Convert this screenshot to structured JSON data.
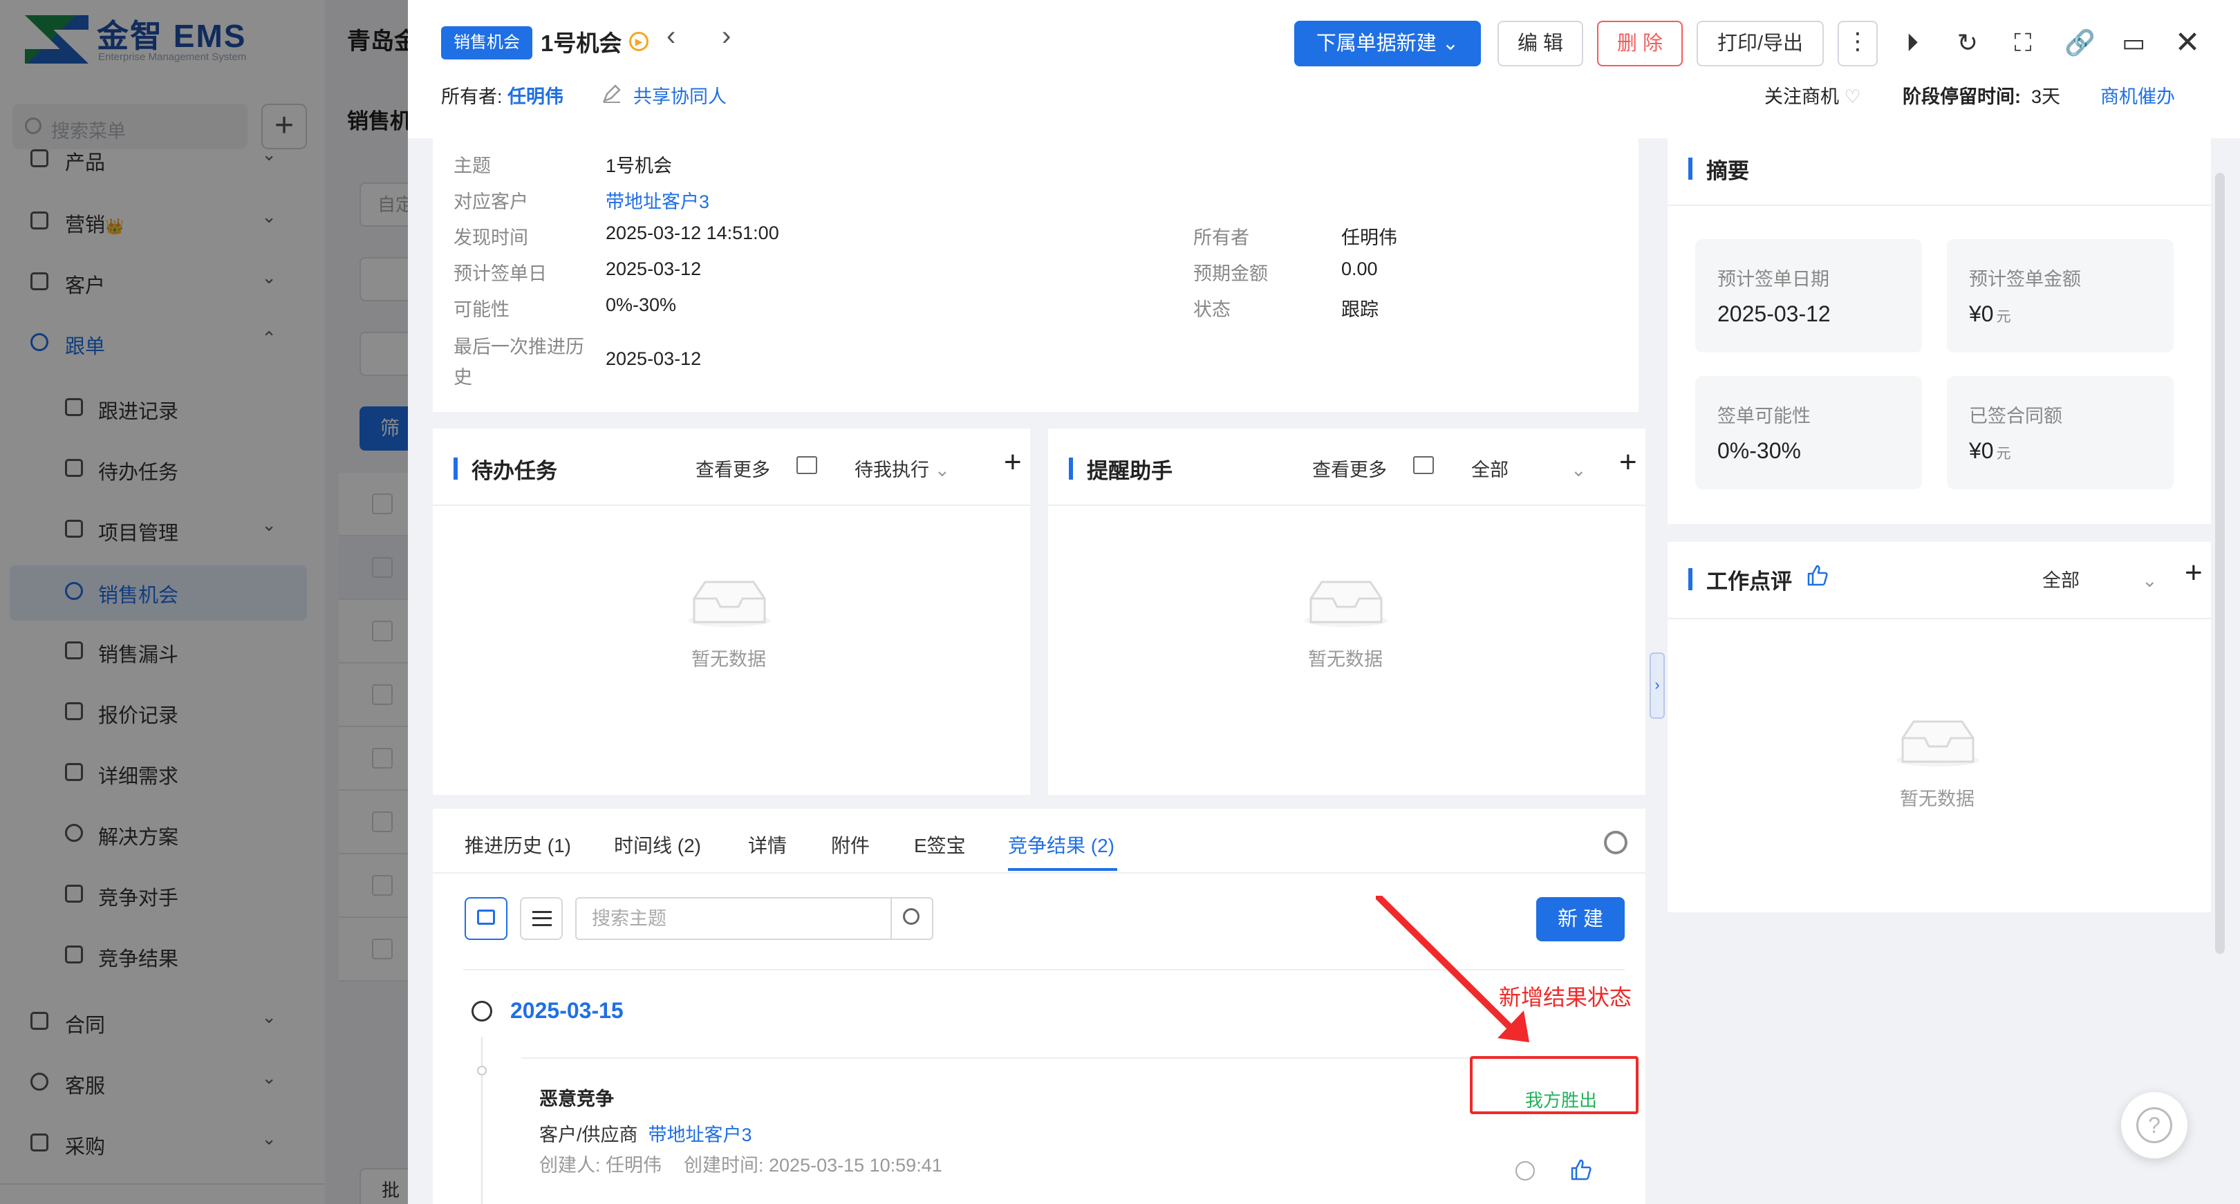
{
  "app": {
    "logo_name": "金智 EMS",
    "logo_subtitle": "Enterprise Management System",
    "bg_company": "青岛金",
    "bg_page_title": "销售机",
    "bg_input_placeholder": "自定",
    "bg_filter_label": "筛",
    "bg_batch_label": "批量"
  },
  "sidebar": {
    "search_placeholder": "搜索菜单",
    "items": [
      {
        "label": "产品",
        "icon": "box-icon",
        "chevron": "⌄"
      },
      {
        "label": "营销",
        "icon": "marketing-icon",
        "chevron": "⌄",
        "badge": "👑"
      },
      {
        "label": "客户",
        "icon": "customer-icon",
        "chevron": "⌄"
      },
      {
        "label": "跟单",
        "icon": "follow-icon",
        "chevron": "⌃"
      },
      {
        "label": "跟进记录",
        "icon": "record-icon"
      },
      {
        "label": "待办任务",
        "icon": "pin-icon"
      },
      {
        "label": "项目管理",
        "icon": "project-icon",
        "chevron": "⌄"
      },
      {
        "label": "销售机会",
        "icon": "target-icon"
      },
      {
        "label": "销售漏斗",
        "icon": "funnel-icon"
      },
      {
        "label": "报价记录",
        "icon": "quote-icon"
      },
      {
        "label": "详细需求",
        "icon": "doc-icon"
      },
      {
        "label": "解决方案",
        "icon": "bulb-icon"
      },
      {
        "label": "竞争对手",
        "icon": "versus-icon"
      },
      {
        "label": "竞争结果",
        "icon": "versus-icon"
      },
      {
        "label": "合同",
        "icon": "contract-icon",
        "chevron": "⌄"
      },
      {
        "label": "客服",
        "icon": "service-icon",
        "chevron": "⌄"
      },
      {
        "label": "采购",
        "icon": "purchase-icon",
        "chevron": "⌄"
      }
    ]
  },
  "drawer": {
    "tag": "销售机会",
    "title": "1号机会",
    "owner_label": "所有者:",
    "owner_name": "任明伟",
    "cowork_label": "共享协同人",
    "buttons": {
      "sub_new": "下属单据新建",
      "edit": "编 辑",
      "delete": "删 除",
      "print_export": "打印/导出"
    },
    "follow_label": "关注商机",
    "stay_label": "阶段停留时间:",
    "stay_value": "3天",
    "urge_label": "商机催办"
  },
  "info": {
    "rows": [
      {
        "label": "主题",
        "value": "1号机会"
      },
      {
        "label": "对应客户",
        "value": "带地址客户3"
      },
      {
        "label": "发现时间",
        "value": "2025-03-12 14:51:00"
      },
      {
        "label": "预计签单日",
        "value": "2025-03-12"
      },
      {
        "label": "可能性",
        "value": "0%-30%"
      },
      {
        "label": "最后一次推进历",
        "label2": "史",
        "value": "2025-03-12"
      }
    ],
    "right_rows": [
      {
        "label": "所有者",
        "value": "任明伟"
      },
      {
        "label": "预期金额",
        "value": "0.00"
      },
      {
        "label": "状态",
        "value": "跟踪"
      }
    ]
  },
  "todo": {
    "title": "待办任务",
    "more": "查看更多",
    "filter": "待我执行",
    "empty": "暂无数据"
  },
  "reminder": {
    "title": "提醒助手",
    "more": "查看更多",
    "filter": "全部",
    "empty": "暂无数据"
  },
  "tabs": {
    "items": [
      "推进历史 (1)",
      "时间线 (2)",
      "详情",
      "附件",
      "E签宝",
      "竞争结果 (2)"
    ],
    "active_index": 5,
    "search_placeholder": "搜索主题",
    "new_label": "新 建"
  },
  "timeline": {
    "date": "2025-03-15",
    "entry": {
      "title": "恶意竞争",
      "partner_label": "客户/供应商",
      "partner_value": "带地址客户3",
      "creator": "创建人: 任明伟",
      "created_at": "创建时间: 2025-03-15 10:59:41",
      "result": "我方胜出",
      "result_color": "#20b35a"
    }
  },
  "annotation": {
    "note": "新增结果状态",
    "color": "#f02a2a"
  },
  "summary": {
    "title": "摘要",
    "stats": [
      {
        "label": "预计签单日期",
        "value": "2025-03-12",
        "unit": ""
      },
      {
        "label": "预计签单金额",
        "value": "¥0",
        "unit": "元"
      },
      {
        "label": "签单可能性",
        "value": "0%-30%",
        "unit": ""
      },
      {
        "label": "已签合同额",
        "value": "¥0",
        "unit": "元"
      }
    ]
  },
  "review": {
    "title": "工作点评",
    "filter": "全部",
    "empty": "暂无数据"
  },
  "colors": {
    "accent": "#1f6fe5",
    "danger": "#f25c5c",
    "success": "#20b35a"
  }
}
